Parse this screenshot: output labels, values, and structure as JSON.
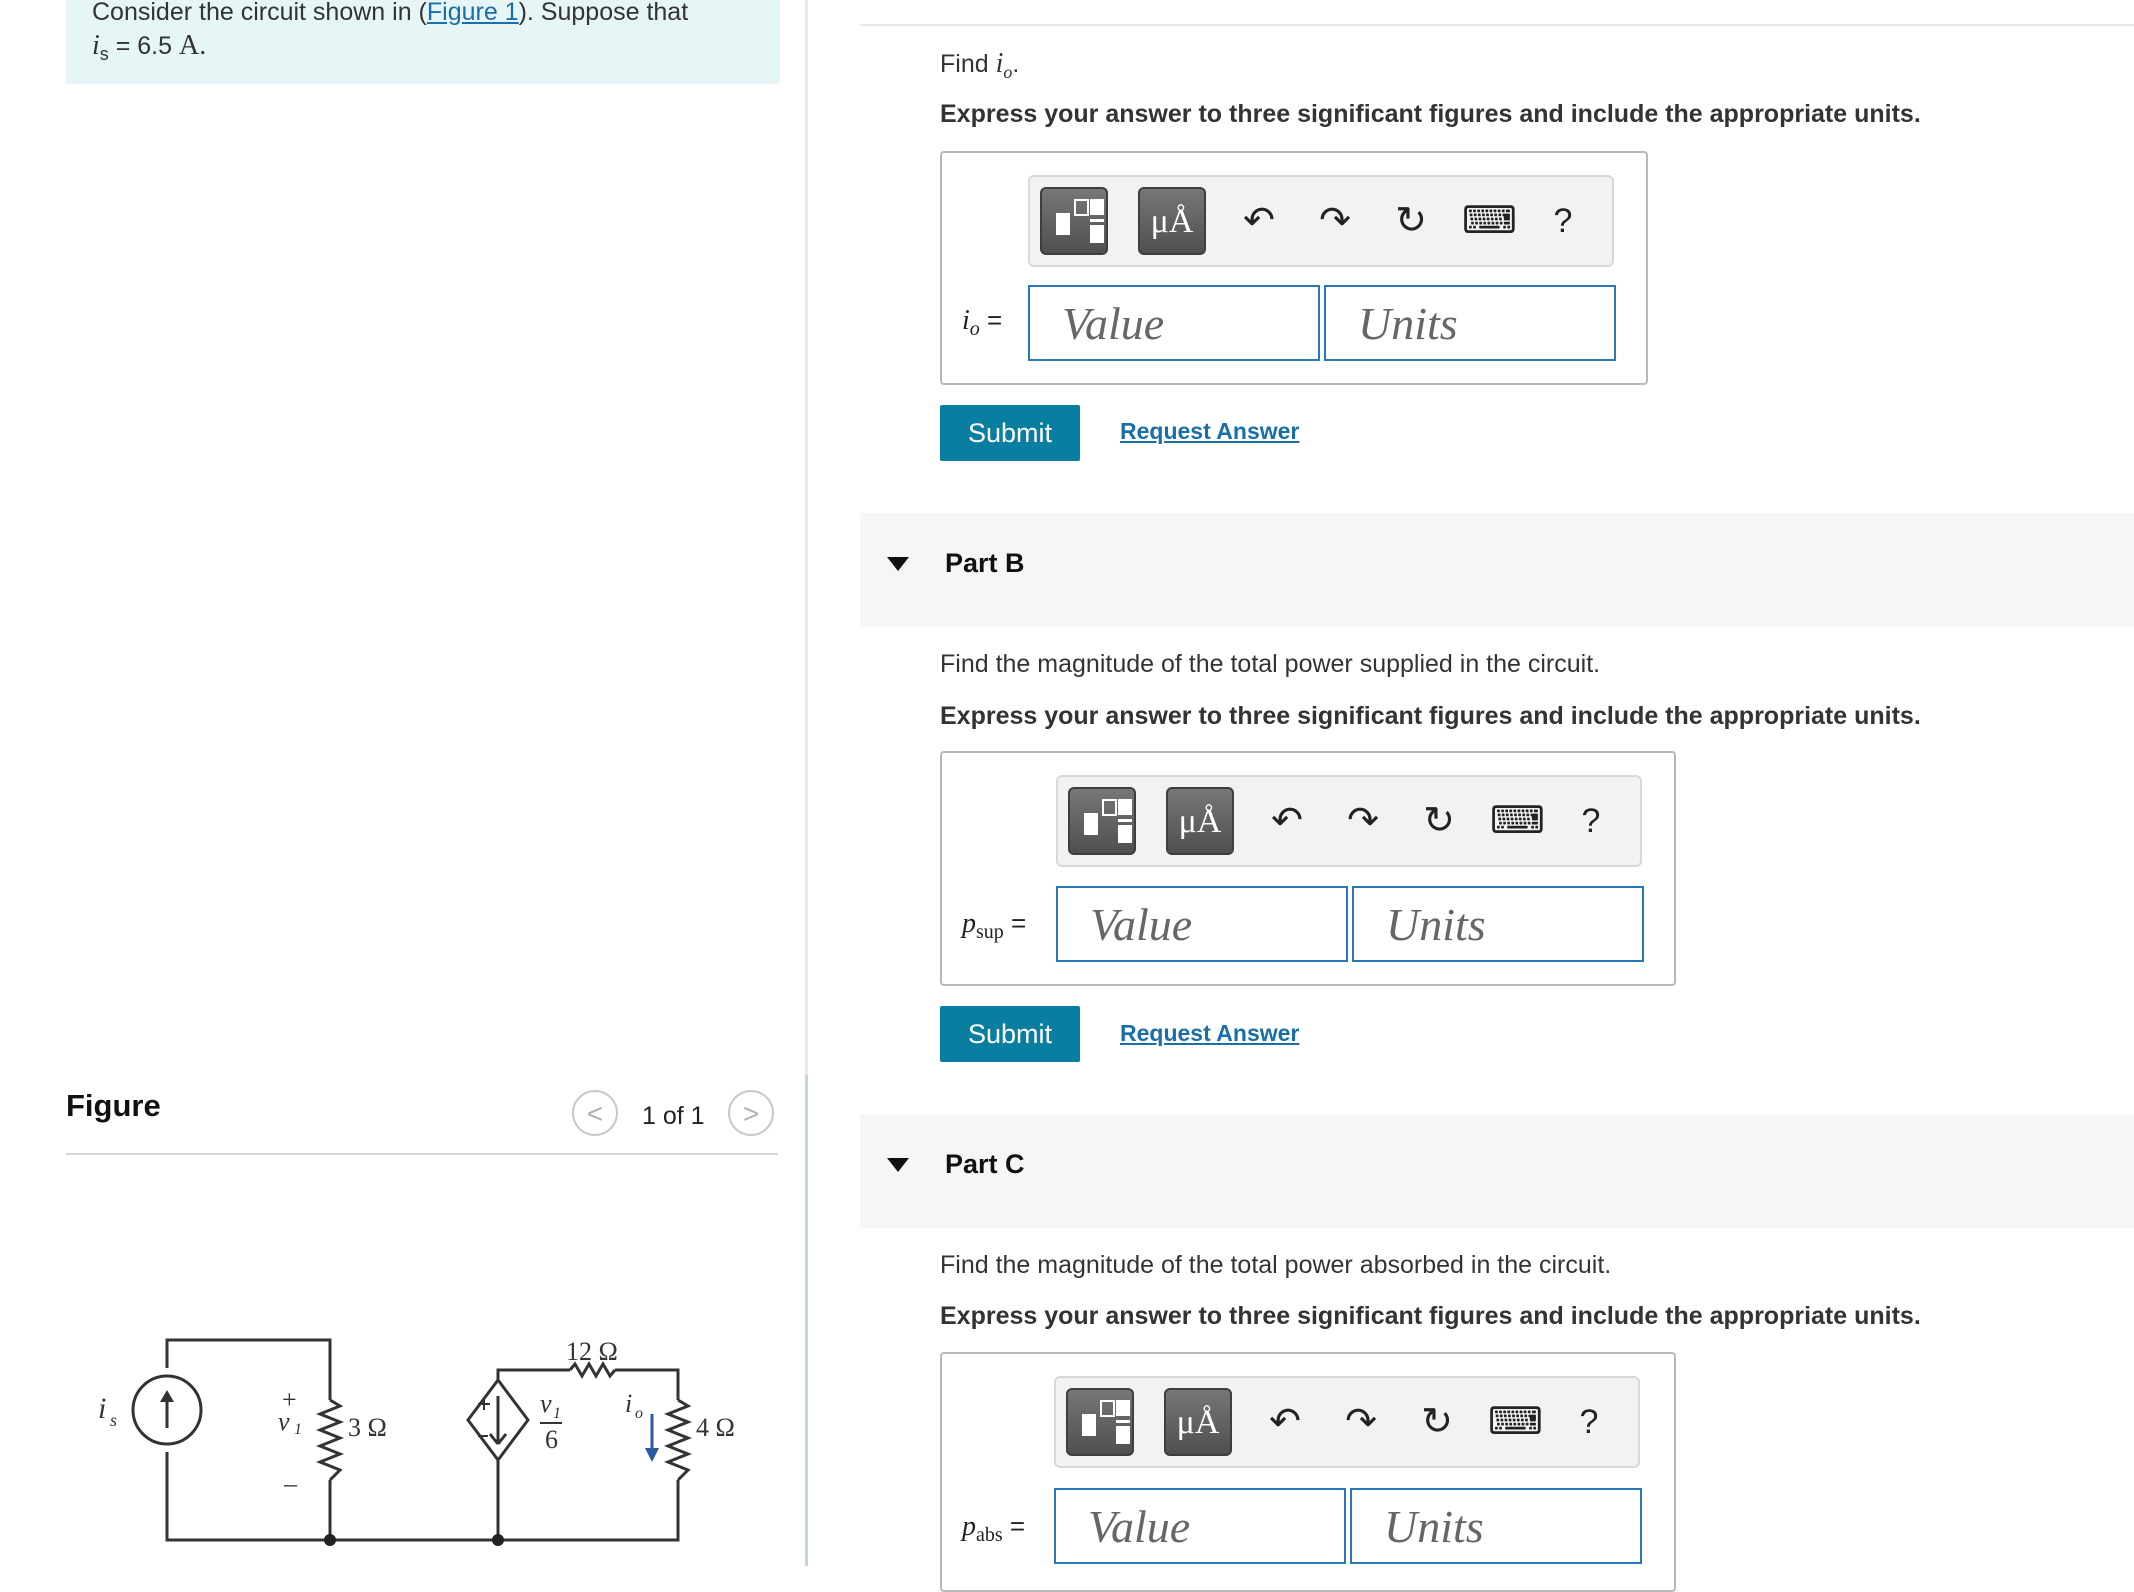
{
  "problem": {
    "intro_before_link": "Consider the circuit shown in (",
    "link_text": "Figure 1",
    "intro_after_link": "). Suppose that",
    "given_var": "i",
    "given_sub": "s",
    "given_eq": " = 6.5 ",
    "given_unit": "A."
  },
  "figure": {
    "title": "Figure",
    "counter": "1 of 1",
    "prev_glyph": "<",
    "next_glyph": ">",
    "circuit_labels": {
      "source": "i",
      "source_sub": "s",
      "plus": "+",
      "minus": "–",
      "v1": "v",
      "v1_sub": "1",
      "r3": "3 Ω",
      "r12": "12 Ω",
      "r4": "4 Ω",
      "dep_num_v": "v",
      "dep_num_sub": "1",
      "dep_den": "6",
      "io": "i",
      "io_sub": "o",
      "dep_plus": "+",
      "dep_minus": "–"
    }
  },
  "toolbar": {
    "units_glyph": "μÅ",
    "undo_glyph": "↶",
    "redo_glyph": "↷",
    "reset_glyph": "↻",
    "keyboard_glyph": "⌨",
    "help_glyph": "?"
  },
  "partA": {
    "question_prefix": "Find ",
    "question_var": "i",
    "question_sub": "o",
    "question_suffix": ".",
    "instruction": "Express your answer to three significant figures and include the appropriate units.",
    "var": "i",
    "var_sub": "o",
    "eq": " =",
    "value_placeholder": "Value",
    "units_placeholder": "Units",
    "submit": "Submit",
    "request": "Request Answer"
  },
  "partB": {
    "title": "Part B",
    "question": "Find the magnitude of the total power supplied in the circuit.",
    "instruction": "Express your answer to three significant figures and include the appropriate units.",
    "var": "p",
    "var_sub": "sup",
    "eq": " =",
    "value_placeholder": "Value",
    "units_placeholder": "Units",
    "submit": "Submit",
    "request": "Request Answer"
  },
  "partC": {
    "title": "Part C",
    "question": "Find the magnitude of the total power absorbed in the circuit.",
    "instruction": "Express your answer to three significant figures and include the appropriate units.",
    "var": "p",
    "var_sub": "abs",
    "eq": " =",
    "value_placeholder": "Value",
    "units_placeholder": "Units"
  }
}
